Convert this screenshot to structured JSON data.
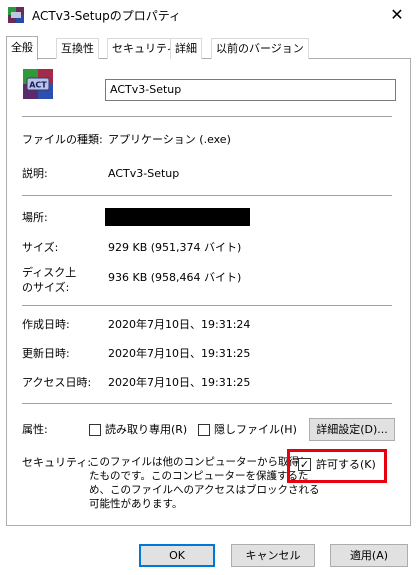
{
  "window": {
    "title": "ACTv3-Setupのプロパティ",
    "close_glyph": "✕"
  },
  "tabs": [
    {
      "label": "全般",
      "active": true
    },
    {
      "label": "互換性",
      "active": false
    },
    {
      "label": "セキュリティ",
      "active": false
    },
    {
      "label": "詳細",
      "active": false
    },
    {
      "label": "以前のバージョン",
      "active": false
    }
  ],
  "file": {
    "icon": "app-icon",
    "icon_text": "ACT",
    "name": "ACTv3-Setup"
  },
  "properties": {
    "type_label": "ファイルの種類:",
    "type_value": "アプリケーション (.exe)",
    "desc_label": "説明:",
    "desc_value": "ACTv3-Setup",
    "location_label": "場所:",
    "size_label": "サイズ:",
    "size_value": "929 KB (951,374 バイト)",
    "disk_label_1": "ディスク上",
    "disk_label_2": "のサイズ:",
    "disk_value": "936 KB (958,464 バイト)",
    "created_label": "作成日時:",
    "created_value": "2020年7月10日、19:31:24",
    "modified_label": "更新日時:",
    "modified_value": "2020年7月10日、19:31:25",
    "accessed_label": "アクセス日時:",
    "accessed_value": "2020年7月10日、19:31:25"
  },
  "attributes": {
    "label": "属性:",
    "readonly_label": "読み取り専用(R)",
    "readonly_checked": false,
    "hidden_label": "隠しファイル(H)",
    "hidden_checked": false,
    "advanced_button": "詳細設定(D)..."
  },
  "security": {
    "label": "セキュリティ:",
    "lines": [
      "このファイルは他のコンピューターから取得し",
      "たものです。このコンピューターを保護するた",
      "め、このファイルへのアクセスはブロックされる",
      "可能性があります。"
    ],
    "allow_label": "許可する(K)",
    "allow_checked": true,
    "check_glyph": "✓",
    "highlight_color": "#e8000f"
  },
  "buttons": {
    "ok": "OK",
    "cancel": "キャンセル",
    "apply": "適用(A)"
  }
}
